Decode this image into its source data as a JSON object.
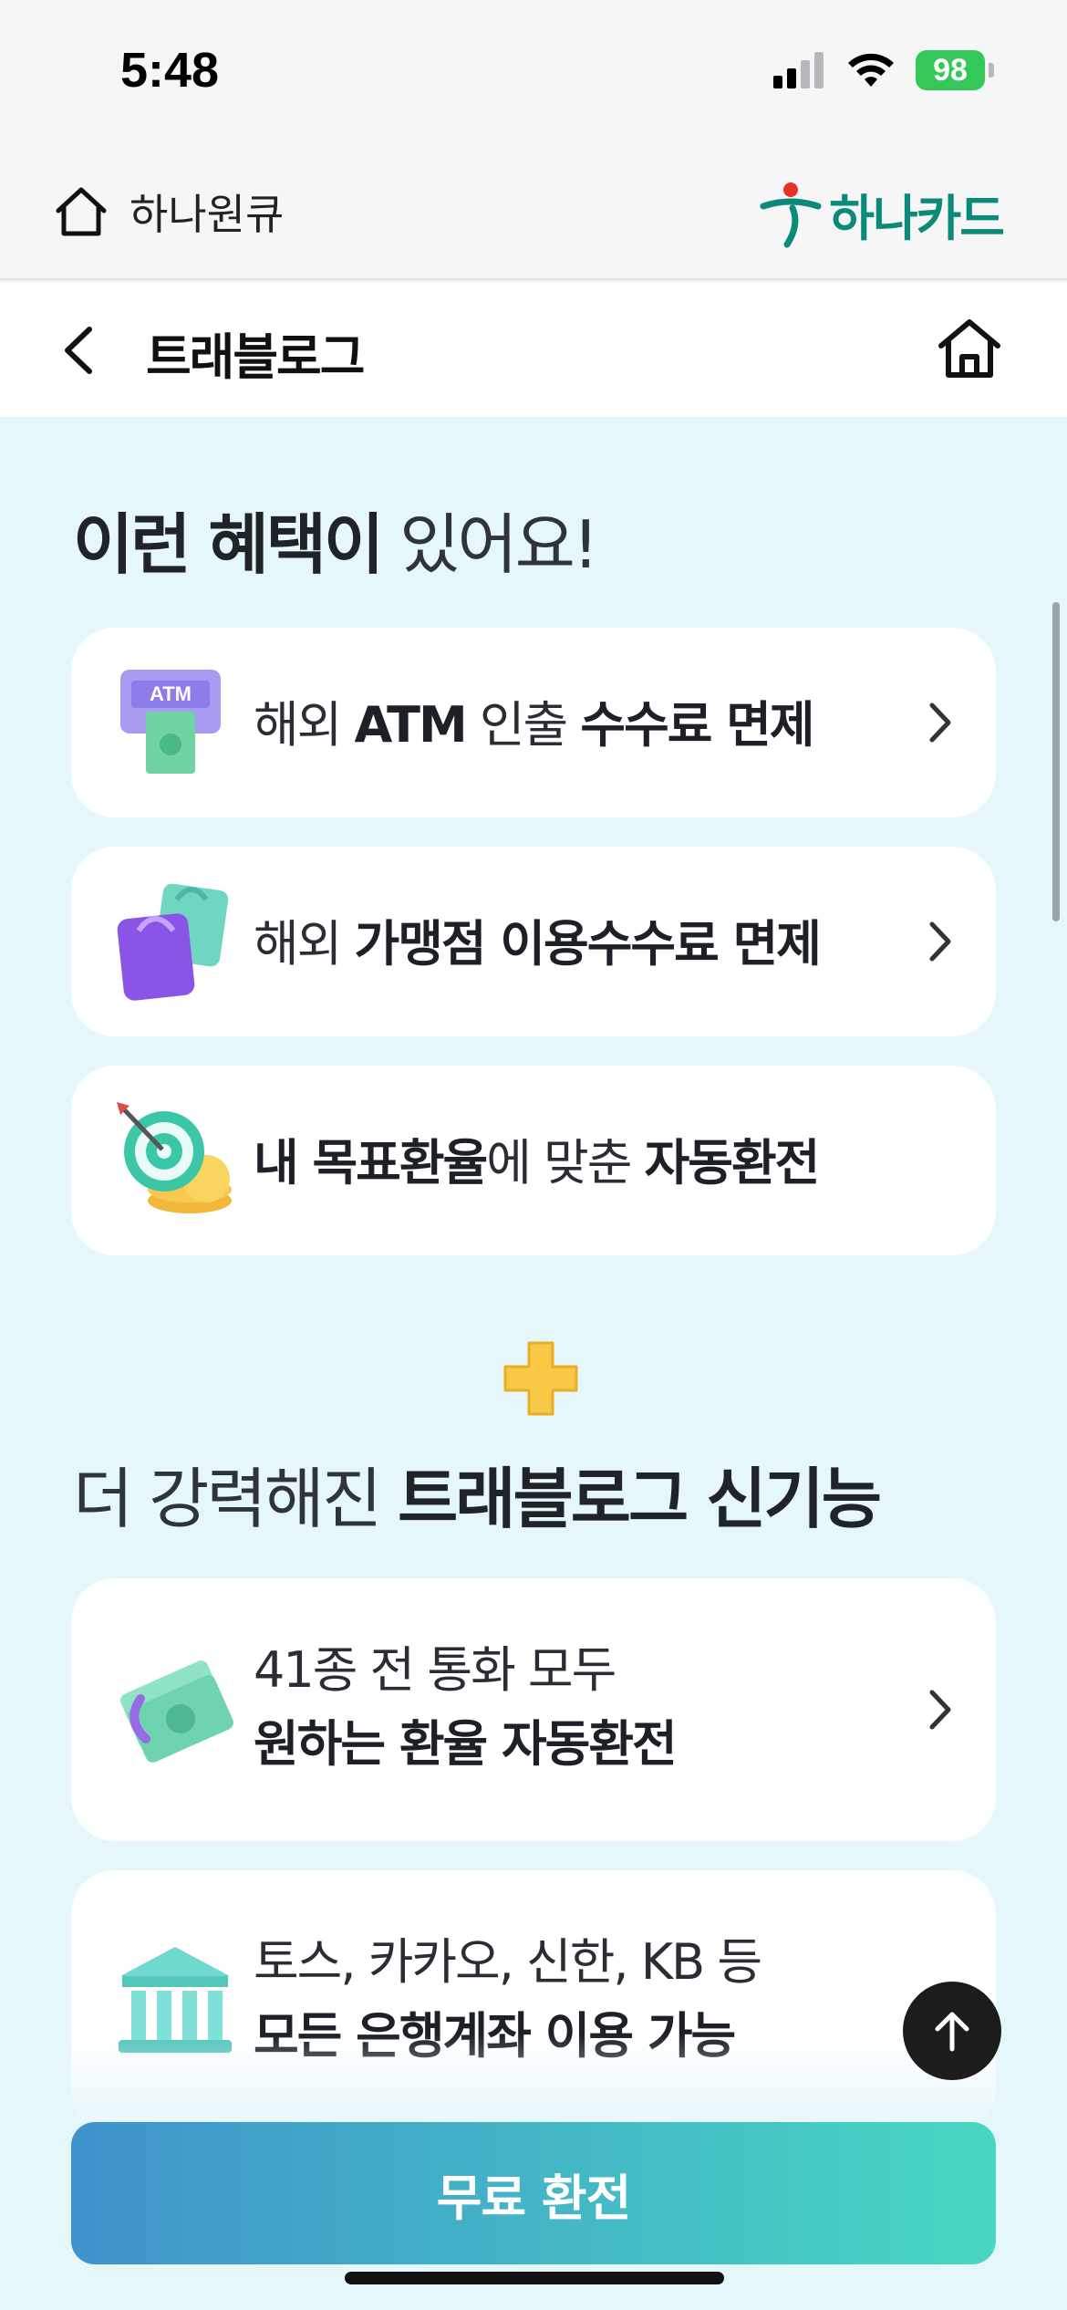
{
  "status": {
    "time": "5:48",
    "battery": "98"
  },
  "header": {
    "home_label": "하나원큐",
    "brand": "하나카드"
  },
  "nav": {
    "title": "트래블로그"
  },
  "benefits": {
    "title_bold": "이런 혜택이",
    "title_light": " 있어요!",
    "items": [
      {
        "icon": "atm-icon",
        "parts": [
          "해외 ",
          "ATM",
          " 인출 ",
          "수수료 면제"
        ]
      },
      {
        "icon": "shopping-bags-icon",
        "parts": [
          "해외 ",
          "가맹점 이용수수료 면제"
        ]
      },
      {
        "icon": "target-coins-icon",
        "parts": [
          "내 목표환율",
          "에 맞춘 ",
          "자동환전"
        ]
      }
    ]
  },
  "features": {
    "title_light": "더 강력해진 ",
    "title_bold": "트래블로그 신기능",
    "items": [
      {
        "icon": "money-exchange-icon",
        "line1": "41종 전 통화 모두",
        "line2": "원하는 환율 자동환전"
      },
      {
        "icon": "bank-icon",
        "line1": "토스, 카카오, 신한, KB 등",
        "line2": "모든 은행계좌 이용 가능"
      }
    ]
  },
  "cta": {
    "label": "무료 환전"
  },
  "colors": {
    "accent_start": "#3f93cb",
    "accent_end": "#48d7c2",
    "background": "#e6f7fb",
    "brand_green": "#0b8a79"
  }
}
